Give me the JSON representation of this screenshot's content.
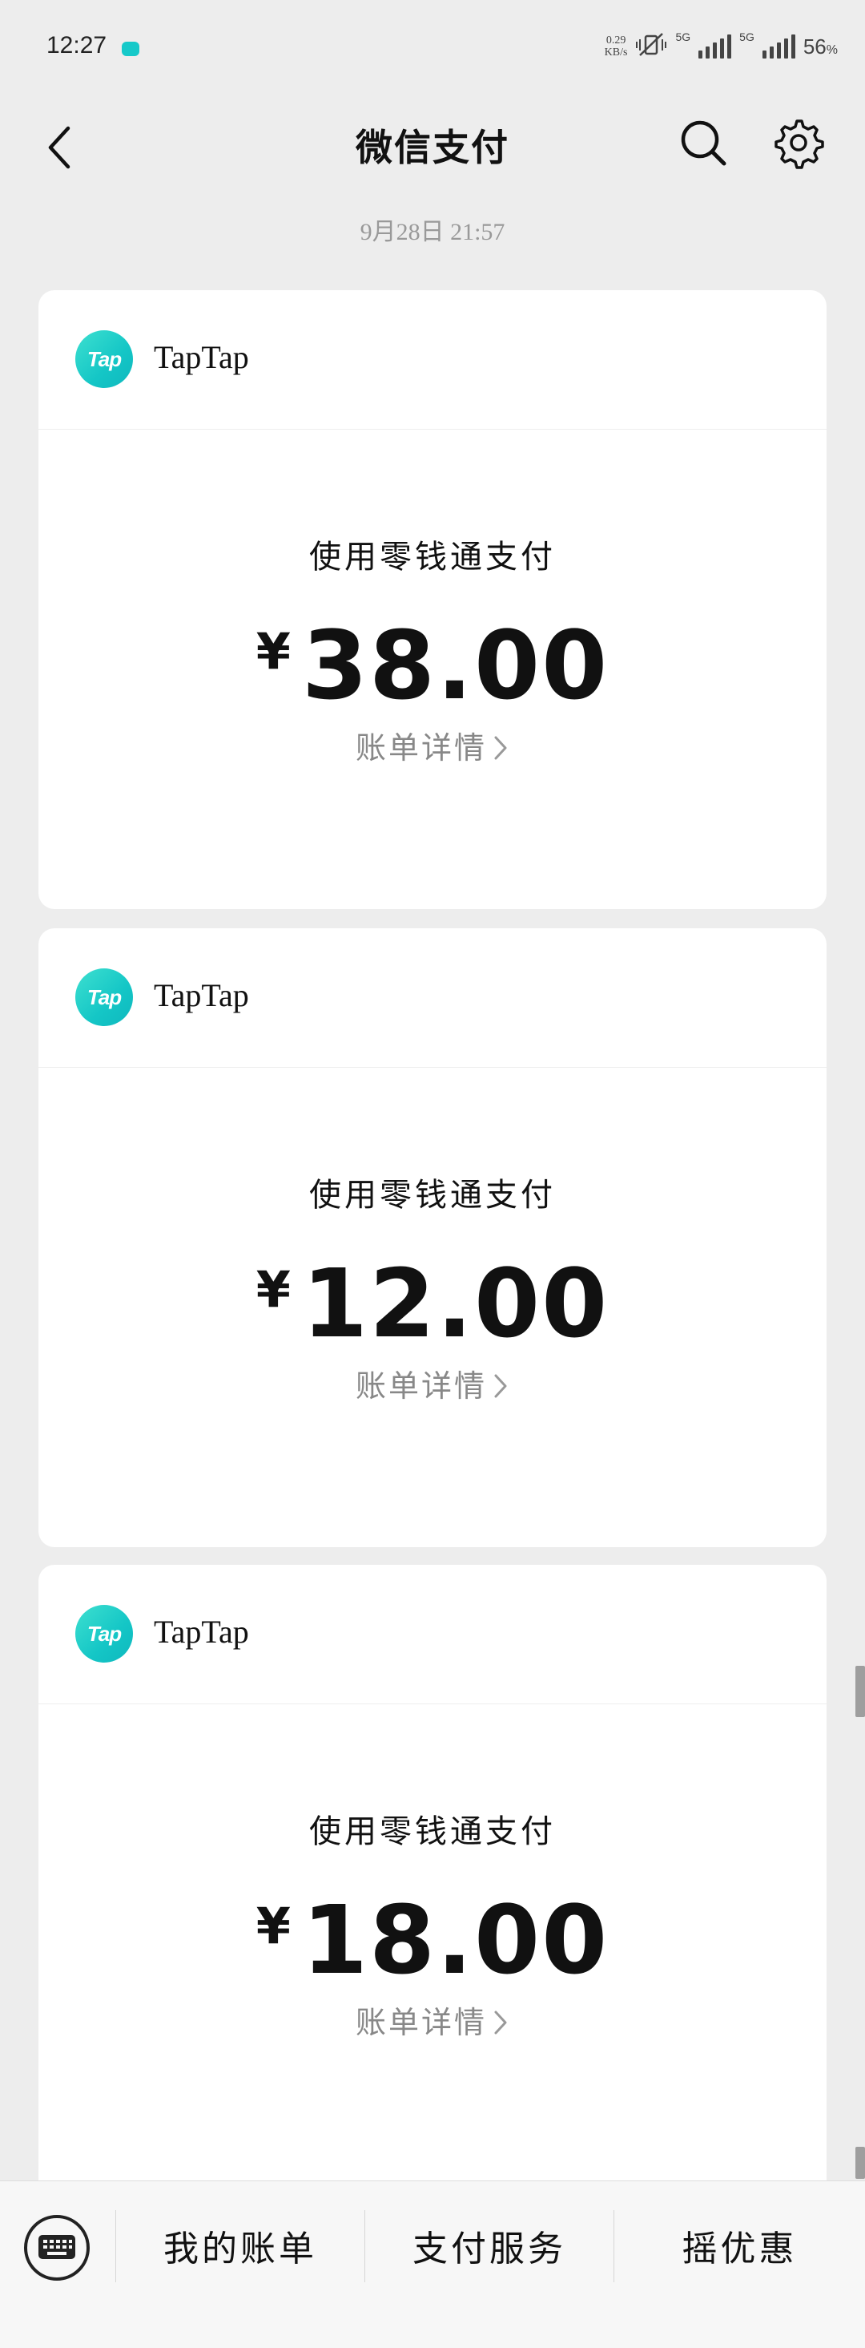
{
  "status_bar": {
    "time": "12:27",
    "net_speed_value": "0.29",
    "net_speed_unit": "KB/s",
    "signal1_label": "5G",
    "signal2_label": "5G",
    "battery": "56",
    "battery_unit": "%"
  },
  "title_bar": {
    "title": "微信支付",
    "icons": [
      "back-arrow-icon",
      "search-icon",
      "gear-icon"
    ]
  },
  "date_stamp": "9月28日  21:57",
  "payments": [
    {
      "merchant": "TapTap",
      "logo_text": "Tap",
      "method": "使用零钱通支付",
      "currency": "¥",
      "amount": "38.00",
      "detail_label": "账单详情"
    },
    {
      "merchant": "TapTap",
      "logo_text": "Tap",
      "method": "使用零钱通支付",
      "currency": "¥",
      "amount": "12.00",
      "detail_label": "账单详情"
    },
    {
      "merchant": "TapTap",
      "logo_text": "Tap",
      "method": "使用零钱通支付",
      "currency": "¥",
      "amount": "18.00",
      "detail_label": "账单详情"
    }
  ],
  "bottom_bar": {
    "tabs": [
      "我的账单",
      "支付服务",
      "摇优惠"
    ],
    "keyboard_icon": "keyboard-icon"
  },
  "colors": {
    "background": "#ededed",
    "card": "#ffffff",
    "brand_teal": "#14c6c6",
    "muted_text": "#888888"
  }
}
